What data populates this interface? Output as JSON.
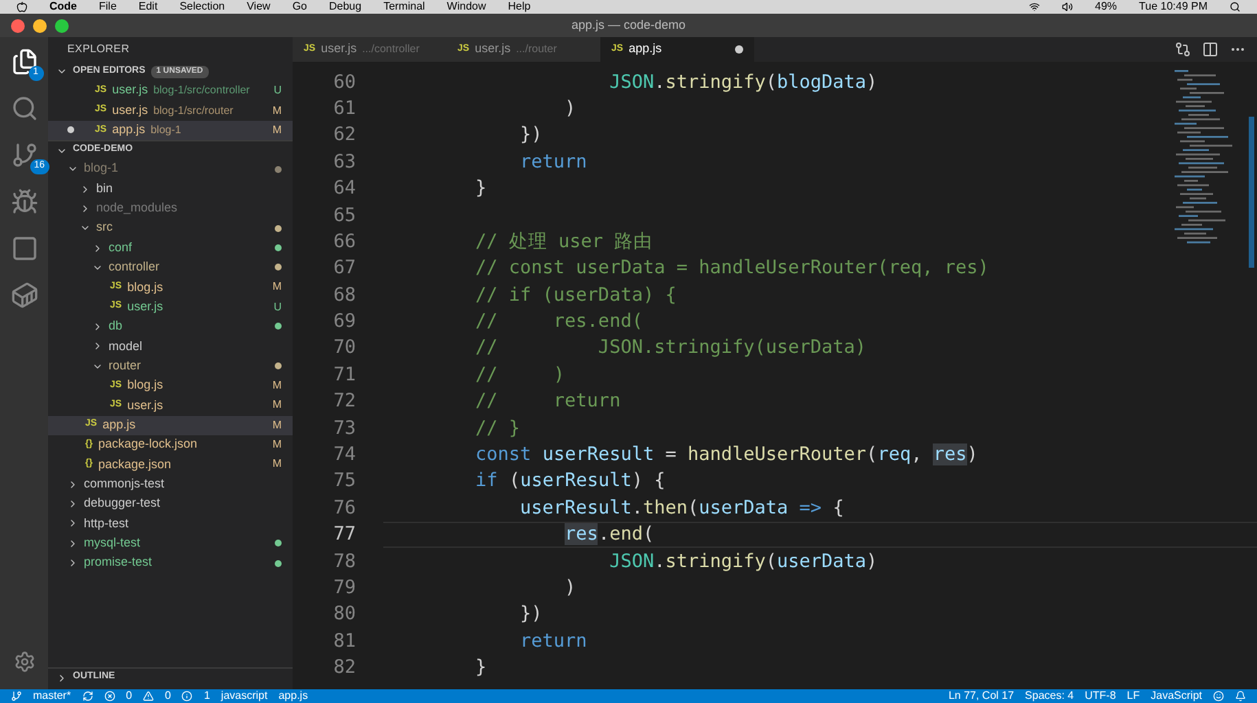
{
  "menu_bar": {
    "app": "Code",
    "items": [
      "File",
      "Edit",
      "Selection",
      "View",
      "Go",
      "Debug",
      "Terminal",
      "Window",
      "Help"
    ],
    "battery": "49%",
    "clock": "Tue 10:49 PM"
  },
  "window": {
    "title": "app.js — code-demo"
  },
  "activity_bar": {
    "explorer_badge": "1",
    "scm_badge": "16"
  },
  "sidebar": {
    "title": "EXPLORER",
    "open_editors": {
      "title": "OPEN EDITORS",
      "badge": "1 UNSAVED",
      "expanded": true,
      "items": [
        {
          "icon": "JS",
          "name": "user.js",
          "path": "blog-1/src/controller",
          "status": "U",
          "color": "#73c991",
          "dirty": false,
          "selected": false
        },
        {
          "icon": "JS",
          "name": "user.js",
          "path": "blog-1/src/router",
          "status": "M",
          "color": "#e2c08d",
          "dirty": false,
          "selected": false
        },
        {
          "icon": "JS",
          "name": "app.js",
          "path": "blog-1",
          "status": "M",
          "color": "#e2c08d",
          "dirty": true,
          "selected": true
        }
      ]
    },
    "workspace": {
      "title": "CODE-DEMO",
      "expanded": true,
      "items": [
        {
          "name": "blog-1",
          "kind": "folder",
          "expanded": true,
          "color": "#8a8170",
          "status_dot": true,
          "children": [
            {
              "name": "bin",
              "kind": "folder",
              "expanded": false,
              "color": "#cccccc",
              "status_dot": false
            },
            {
              "name": "node_modules",
              "kind": "folder",
              "expanded": false,
              "color": "#7a7a7a",
              "status_dot": false
            },
            {
              "name": "src",
              "kind": "folder",
              "expanded": true,
              "color": "#c3b28a",
              "status_dot": true,
              "children": [
                {
                  "name": "conf",
                  "kind": "folder",
                  "expanded": false,
                  "color": "#73c991",
                  "status_dot": true
                },
                {
                  "name": "controller",
                  "kind": "folder",
                  "expanded": true,
                  "color": "#c3b28a",
                  "status_dot": true,
                  "children": [
                    {
                      "name": "blog.js",
                      "kind": "file",
                      "icon": "JS",
                      "color": "#e2c08d",
                      "status": "M",
                      "selected": false
                    },
                    {
                      "name": "user.js",
                      "kind": "file",
                      "icon": "JS",
                      "color": "#73c991",
                      "status": "U",
                      "selected": false
                    }
                  ]
                },
                {
                  "name": "db",
                  "kind": "folder",
                  "expanded": false,
                  "color": "#73c991",
                  "status_dot": true
                },
                {
                  "name": "model",
                  "kind": "folder",
                  "expanded": false,
                  "color": "#cccccc",
                  "status_dot": false
                },
                {
                  "name": "router",
                  "kind": "folder",
                  "expanded": true,
                  "color": "#c3b28a",
                  "status_dot": true,
                  "children": [
                    {
                      "name": "blog.js",
                      "kind": "file",
                      "icon": "JS",
                      "color": "#e2c08d",
                      "status": "M",
                      "selected": false
                    },
                    {
                      "name": "user.js",
                      "kind": "file",
                      "icon": "JS",
                      "color": "#e2c08d",
                      "status": "M",
                      "selected": false
                    }
                  ]
                }
              ]
            },
            {
              "name": "app.js",
              "kind": "file",
              "icon": "JS",
              "color": "#e2c08d",
              "status": "M",
              "selected": true
            },
            {
              "name": "package-lock.json",
              "kind": "file",
              "icon": "{}",
              "color": "#e2c08d",
              "status": "M",
              "selected": false
            },
            {
              "name": "package.json",
              "kind": "file",
              "icon": "{}",
              "color": "#e2c08d",
              "status": "M",
              "selected": false
            }
          ]
        },
        {
          "name": "commonjs-test",
          "kind": "folder",
          "expanded": false,
          "color": "#cccccc",
          "status_dot": false
        },
        {
          "name": "debugger-test",
          "kind": "folder",
          "expanded": false,
          "color": "#cccccc",
          "status_dot": false
        },
        {
          "name": "http-test",
          "kind": "folder",
          "expanded": false,
          "color": "#cccccc",
          "status_dot": false
        },
        {
          "name": "mysql-test",
          "kind": "folder",
          "expanded": false,
          "color": "#73c991",
          "status_dot": true
        },
        {
          "name": "promise-test",
          "kind": "folder",
          "expanded": false,
          "color": "#73c991",
          "status_dot": true
        }
      ]
    },
    "outline": {
      "title": "OUTLINE",
      "expanded": false
    }
  },
  "tabs": [
    {
      "icon": "JS",
      "name": "user.js",
      "path": ".../controller",
      "selected": false,
      "dirty": false
    },
    {
      "icon": "JS",
      "name": "user.js",
      "path": ".../router",
      "selected": false,
      "dirty": false
    },
    {
      "icon": "JS",
      "name": "app.js",
      "selected": true,
      "dirty": true
    }
  ],
  "editor": {
    "lines": [
      {
        "number": "60",
        "current": false,
        "tokens": [
          {
            "t": "                    JSON",
            "kind": "type"
          },
          {
            "t": ".",
            "kind": "plain"
          },
          {
            "t": "stringify",
            "kind": "fn"
          },
          {
            "t": "(",
            "kind": "plain"
          },
          {
            "t": "blogData",
            "kind": "var"
          },
          {
            "t": ")",
            "kind": "plain"
          }
        ]
      },
      {
        "number": "61",
        "current": false,
        "tokens": [
          {
            "t": "                )",
            "kind": "plain"
          }
        ]
      },
      {
        "number": "62",
        "current": false,
        "tokens": [
          {
            "t": "            })",
            "kind": "plain"
          }
        ]
      },
      {
        "number": "63",
        "current": false,
        "tokens": [
          {
            "t": "            return",
            "kind": "kw"
          }
        ]
      },
      {
        "number": "64",
        "current": false,
        "tokens": [
          {
            "t": "        }",
            "kind": "plain"
          }
        ]
      },
      {
        "number": "65",
        "current": false
      },
      {
        "number": "66",
        "current": false,
        "tokens": [
          {
            "t": "        // 处理 user 路由",
            "kind": "comment"
          }
        ]
      },
      {
        "number": "67",
        "current": false,
        "tokens": [
          {
            "t": "        // const userData = handleUserRouter(req, res)",
            "kind": "comment"
          }
        ]
      },
      {
        "number": "68",
        "current": false,
        "tokens": [
          {
            "t": "        // if (userData) {",
            "kind": "comment"
          }
        ]
      },
      {
        "number": "69",
        "current": false,
        "tokens": [
          {
            "t": "        //     res.end(",
            "kind": "comment"
          }
        ]
      },
      {
        "number": "70",
        "current": false,
        "tokens": [
          {
            "t": "        //         JSON.stringify(userData)",
            "kind": "comment"
          }
        ]
      },
      {
        "number": "71",
        "current": false,
        "tokens": [
          {
            "t": "        //     )",
            "kind": "comment"
          }
        ]
      },
      {
        "number": "72",
        "current": false,
        "tokens": [
          {
            "t": "        //     return",
            "kind": "comment"
          }
        ]
      },
      {
        "number": "73",
        "current": false,
        "tokens": [
          {
            "t": "        // }",
            "kind": "comment"
          }
        ]
      },
      {
        "number": "74",
        "current": false,
        "tokens": [
          {
            "t": "        const",
            "kind": "kw"
          },
          {
            "t": " userResult",
            "kind": "var"
          },
          {
            "t": " = ",
            "kind": "plain"
          },
          {
            "t": "handleUserRouter",
            "kind": "fn"
          },
          {
            "t": "(",
            "kind": "plain"
          },
          {
            "t": "req",
            "kind": "var"
          },
          {
            "t": ", ",
            "kind": "plain"
          },
          {
            "t": "res",
            "kind": "var",
            "highlight": true
          },
          {
            "t": ")",
            "kind": "plain"
          }
        ]
      },
      {
        "number": "75",
        "current": false,
        "tokens": [
          {
            "t": "        if",
            "kind": "kw"
          },
          {
            "t": " (",
            "kind": "plain"
          },
          {
            "t": "userResult",
            "kind": "var"
          },
          {
            "t": ") {",
            "kind": "plain"
          }
        ]
      },
      {
        "number": "76",
        "current": false,
        "tokens": [
          {
            "t": "            userResult",
            "kind": "var"
          },
          {
            "t": ".",
            "kind": "plain"
          },
          {
            "t": "then",
            "kind": "fn"
          },
          {
            "t": "(",
            "kind": "plain"
          },
          {
            "t": "userData",
            "kind": "var"
          },
          {
            "t": " =>",
            "kind": "kw"
          },
          {
            "t": " {",
            "kind": "plain"
          }
        ]
      },
      {
        "number": "77",
        "current": true,
        "tokens": [
          {
            "t": "                res",
            "kind": "var",
            "highlight": true
          },
          {
            "t": ".",
            "kind": "plain"
          },
          {
            "t": "end",
            "kind": "fn"
          },
          {
            "t": "(",
            "kind": "plain"
          }
        ]
      },
      {
        "number": "78",
        "current": false,
        "tokens": [
          {
            "t": "                    JSON",
            "kind": "type"
          },
          {
            "t": ".",
            "kind": "plain"
          },
          {
            "t": "stringify",
            "kind": "fn"
          },
          {
            "t": "(",
            "kind": "plain"
          },
          {
            "t": "userData",
            "kind": "var"
          },
          {
            "t": ")",
            "kind": "plain"
          }
        ]
      },
      {
        "number": "79",
        "current": false,
        "tokens": [
          {
            "t": "                )",
            "kind": "plain"
          }
        ]
      },
      {
        "number": "80",
        "current": false,
        "tokens": [
          {
            "t": "            })",
            "kind": "plain"
          }
        ]
      },
      {
        "number": "81",
        "current": false,
        "tokens": [
          {
            "t": "            return",
            "kind": "kw"
          }
        ]
      },
      {
        "number": "82",
        "current": false,
        "tokens": [
          {
            "t": "        }",
            "kind": "plain"
          }
        ]
      }
    ]
  },
  "status_bar": {
    "branch": "master*",
    "errors": "0",
    "warnings": "0",
    "infos": "1",
    "language_id": "javascript",
    "file": "app.js",
    "position": "Ln 77, Col 17",
    "indent": "Spaces: 4",
    "encoding": "UTF-8",
    "eol": "LF",
    "language": "JavaScript"
  }
}
